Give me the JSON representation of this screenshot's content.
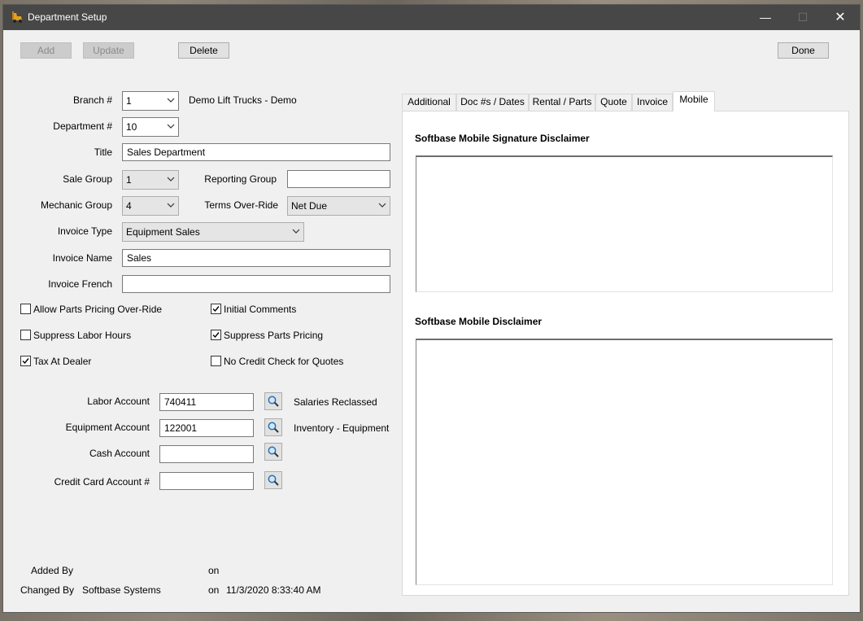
{
  "window": {
    "title": "Department Setup"
  },
  "title_controls": {
    "minimize": "—",
    "maximize": "☐",
    "close": "✕"
  },
  "toolbar": {
    "add": "Add",
    "update": "Update",
    "delete": "Delete",
    "done": "Done"
  },
  "form": {
    "branch": {
      "label": "Branch #",
      "value": "1",
      "name": "Demo Lift Trucks - Demo"
    },
    "department": {
      "label": "Department #",
      "value": "10"
    },
    "title": {
      "label": "Title",
      "value": "Sales Department"
    },
    "sale_group": {
      "label": "Sale Group",
      "value": "1"
    },
    "reporting_group": {
      "label": "Reporting Group",
      "value": ""
    },
    "mechanic_group": {
      "label": "Mechanic Group",
      "value": "4"
    },
    "terms_override": {
      "label": "Terms Over-Ride",
      "value": "Net Due"
    },
    "invoice_type": {
      "label": "Invoice Type",
      "value": "Equipment Sales"
    },
    "invoice_name": {
      "label": "Invoice Name",
      "value": "Sales"
    },
    "invoice_french": {
      "label": "Invoice French",
      "value": ""
    }
  },
  "checkboxes": {
    "allow_parts_pricing": {
      "label": "Allow Parts Pricing Over-Ride",
      "checked": false
    },
    "initial_comments": {
      "label": "Initial Comments",
      "checked": true
    },
    "suppress_labor_hours": {
      "label": "Suppress Labor Hours",
      "checked": false
    },
    "suppress_parts_pricing": {
      "label": "Suppress Parts Pricing",
      "checked": true
    },
    "tax_at_dealer": {
      "label": "Tax At Dealer",
      "checked": true
    },
    "no_credit_check": {
      "label": "No Credit Check for Quotes",
      "checked": false
    }
  },
  "accounts": {
    "labor": {
      "label": "Labor Account",
      "value": "740411",
      "desc": "Salaries Reclassed"
    },
    "equipment": {
      "label": "Equipment Account",
      "value": "122001",
      "desc": "Inventory - Equipment"
    },
    "cash": {
      "label": "Cash Account",
      "value": "",
      "desc": ""
    },
    "credit_card": {
      "label": "Credit Card Account #",
      "value": "",
      "desc": ""
    }
  },
  "audit": {
    "added_by_label": "Added By",
    "added_by": "",
    "added_on_label": "on",
    "added_on": "",
    "changed_by_label": "Changed By",
    "changed_by": "Softbase Systems",
    "changed_on_label": "on",
    "changed_on": "11/3/2020 8:33:40 AM"
  },
  "tabs": [
    "Additional",
    "Doc #s / Dates",
    "Rental / Parts",
    "Quote",
    "Invoice",
    "Mobile"
  ],
  "active_tab": "Mobile",
  "mobile": {
    "signature_disclaimer_label": "Softbase Mobile Signature Disclaimer",
    "signature_disclaimer": "",
    "disclaimer_label": "Softbase Mobile Disclaimer",
    "disclaimer": ""
  },
  "icons": {
    "app": "forklift-app-icon",
    "lookup": "magnifier-icon",
    "dropdown": "chevron-down-icon",
    "check": "checkmark-icon"
  },
  "colors": {
    "titlebar": "#474747",
    "window_bg": "#f0f0f0",
    "disabled_text": "#8a8a8a"
  }
}
